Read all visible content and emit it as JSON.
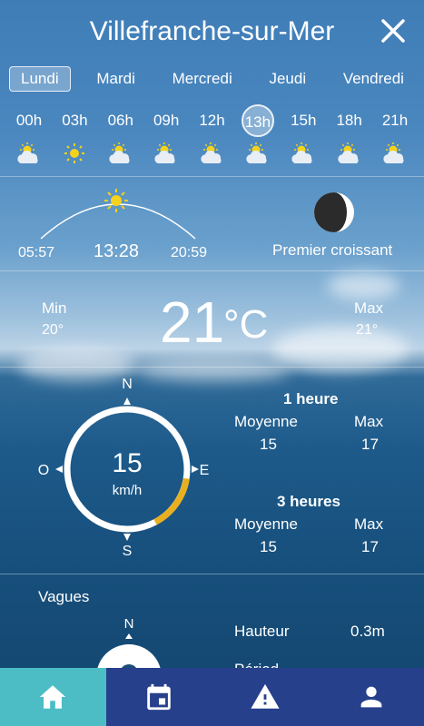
{
  "header": {
    "title": "Villefranche-sur-Mer"
  },
  "days": [
    {
      "label": "Lundi",
      "active": true
    },
    {
      "label": "Mardi",
      "active": false
    },
    {
      "label": "Mercredi",
      "active": false
    },
    {
      "label": "Jeudi",
      "active": false
    },
    {
      "label": "Vendredi",
      "active": false
    }
  ],
  "hours": [
    {
      "label": "00h",
      "icon": "cloud-sun-icon"
    },
    {
      "label": "03h",
      "icon": "sun-icon"
    },
    {
      "label": "06h",
      "icon": "cloud-sun-icon"
    },
    {
      "label": "09h",
      "icon": "cloud-sun-icon"
    },
    {
      "label": "12h",
      "icon": "cloud-sun-icon"
    },
    {
      "label": "13h",
      "icon": "cloud-sun-icon",
      "active": true
    },
    {
      "label": "15h",
      "icon": "cloud-sun-icon"
    },
    {
      "label": "18h",
      "icon": "cloud-sun-icon"
    },
    {
      "label": "21h",
      "icon": "cloud-sun-icon"
    }
  ],
  "sun": {
    "sunrise": "05:57",
    "current": "13:28",
    "sunset": "20:59"
  },
  "moon": {
    "phase": "Premier croissant"
  },
  "temperature": {
    "min_label": "Min",
    "min": "20°",
    "max_label": "Max",
    "max": "21°",
    "current": "21",
    "unit": "°C"
  },
  "wind": {
    "speed": "15",
    "unit": "km/h",
    "directions": {
      "n": "N",
      "e": "E",
      "s": "S",
      "o": "O"
    },
    "one_hour": {
      "title": "1 heure",
      "avg_label": "Moyenne",
      "avg": "15",
      "max_label": "Max",
      "max": "17"
    },
    "three_hours": {
      "title": "3 heures",
      "avg_label": "Moyenne",
      "avg": "15",
      "max_label": "Max",
      "max": "17"
    }
  },
  "waves": {
    "label": "Vagues",
    "north": "N",
    "height_label": "Hauteur",
    "height": "0.3m",
    "period_label": "Périod"
  },
  "nav": [
    {
      "icon": "home-icon",
      "active": true
    },
    {
      "icon": "calendar-icon",
      "active": false
    },
    {
      "icon": "warning-icon",
      "active": false
    },
    {
      "icon": "user-icon",
      "active": false
    }
  ],
  "colors": {
    "accent": "#4dbdc5",
    "nav_bg": "#27408c",
    "sun": "#f5d21c",
    "wind_arc": "#e8b020"
  }
}
